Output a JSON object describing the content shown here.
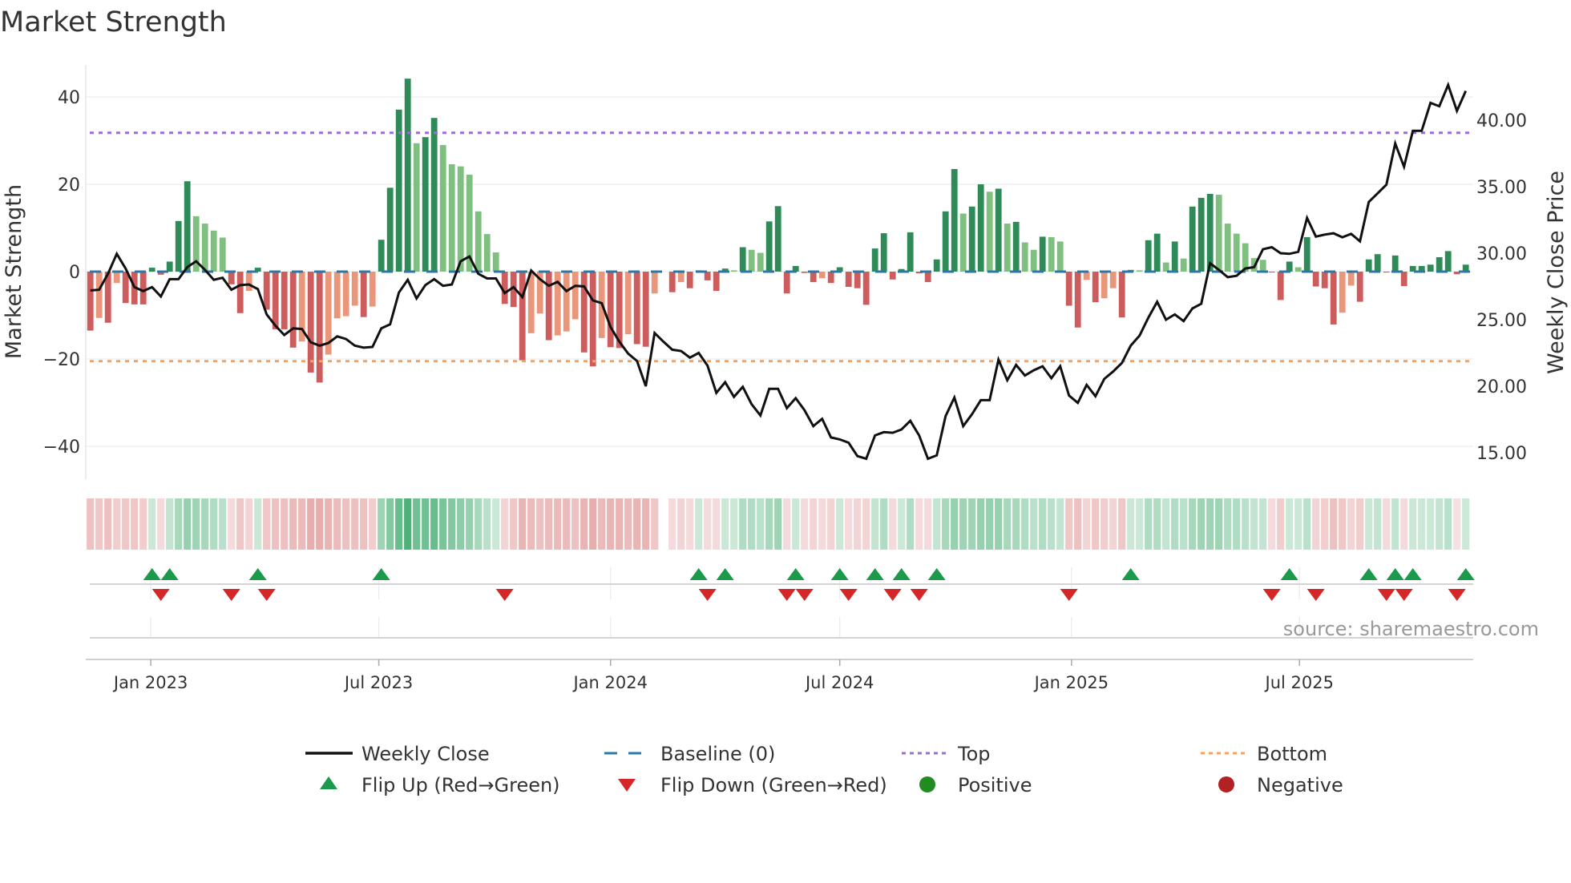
{
  "chart_data": {
    "type": "bar",
    "title": "Market Strength",
    "ylabel": "Market Strength",
    "y2label": "Weekly Close Price",
    "source": "source: sharemaestro.com",
    "ylim": [
      -48,
      48
    ],
    "y2lim": [
      13,
      43.5
    ],
    "yticks": [
      40,
      20,
      0,
      -20,
      -40
    ],
    "yticklabels": [
      "40",
      "20",
      "0",
      "−20",
      "−40"
    ],
    "y2ticks": [
      40,
      35,
      30,
      25,
      20,
      15
    ],
    "y2ticklabels": [
      "40.00",
      "35.00",
      "30.00",
      "25.00",
      "20.00",
      "15.00"
    ],
    "xticks": [
      "2023-01-01",
      "2023-07-01",
      "2024-01-01",
      "2024-07-01",
      "2025-01-01",
      "2025-07-01"
    ],
    "xticklabels": [
      "Jan 2023",
      "Jul 2023",
      "Jan 2024",
      "Jul 2024",
      "Jan 2025",
      "Jul 2025"
    ],
    "grid": true,
    "legend_placement": "bottom",
    "top_level": 31.8,
    "bottom_level": -20.5,
    "colors": {
      "pos_strong": "#2e8b57",
      "pos_weak": "#7fbf7f",
      "neg_strong": "#cd5c5c",
      "neg_weak": "#e9967a",
      "close": "#111111",
      "baseline": "#2a78a8",
      "top": "#9b6ddb",
      "bottom": "#f4a261",
      "flip_up": "#1a9a4a",
      "flip_down": "#d62728",
      "positive": "#228b22",
      "negative": "#b22222",
      "heat_pos": "#2ca25f",
      "heat_neg": "#d46a6a"
    },
    "dates": [
      "2022-11-14",
      "2022-11-21",
      "2022-11-28",
      "2022-12-05",
      "2022-12-12",
      "2022-12-19",
      "2022-12-26",
      "2023-01-02",
      "2023-01-09",
      "2023-01-16",
      "2023-01-23",
      "2023-01-30",
      "2023-02-06",
      "2023-02-13",
      "2023-02-20",
      "2023-02-27",
      "2023-03-06",
      "2023-03-13",
      "2023-03-20",
      "2023-03-27",
      "2023-04-03",
      "2023-04-10",
      "2023-04-17",
      "2023-04-24",
      "2023-05-01",
      "2023-05-08",
      "2023-05-15",
      "2023-05-22",
      "2023-05-29",
      "2023-06-05",
      "2023-06-12",
      "2023-06-19",
      "2023-06-26",
      "2023-07-03",
      "2023-07-10",
      "2023-07-17",
      "2023-07-24",
      "2023-07-31",
      "2023-08-07",
      "2023-08-14",
      "2023-08-21",
      "2023-08-28",
      "2023-09-04",
      "2023-09-11",
      "2023-09-18",
      "2023-09-25",
      "2023-10-02",
      "2023-10-09",
      "2023-10-16",
      "2023-10-23",
      "2023-10-30",
      "2023-11-06",
      "2023-11-13",
      "2023-11-20",
      "2023-11-27",
      "2023-12-04",
      "2023-12-11",
      "2023-12-18",
      "2023-12-25",
      "2024-01-01",
      "2024-01-08",
      "2024-01-15",
      "2024-01-22",
      "2024-01-29",
      "2024-02-05",
      "2024-02-12",
      "2024-02-19",
      "2024-02-26",
      "2024-03-04",
      "2024-03-11",
      "2024-03-18",
      "2024-03-25",
      "2024-04-01",
      "2024-04-08",
      "2024-04-15",
      "2024-04-22",
      "2024-04-29",
      "2024-05-06",
      "2024-05-13",
      "2024-05-20",
      "2024-05-27",
      "2024-06-03",
      "2024-06-10",
      "2024-06-17",
      "2024-06-24",
      "2024-07-01",
      "2024-07-08",
      "2024-07-15",
      "2024-07-22",
      "2024-07-29",
      "2024-08-05",
      "2024-08-12",
      "2024-08-19",
      "2024-08-26",
      "2024-09-02",
      "2024-09-09",
      "2024-09-16",
      "2024-09-23",
      "2024-09-30",
      "2024-10-07",
      "2024-10-14",
      "2024-10-21",
      "2024-10-28",
      "2024-11-04",
      "2024-11-11",
      "2024-11-18",
      "2024-11-25",
      "2024-12-02",
      "2024-12-09",
      "2024-12-16",
      "2024-12-23",
      "2024-12-30",
      "2025-01-06",
      "2025-01-13",
      "2025-01-20",
      "2025-01-27",
      "2025-02-03",
      "2025-02-10",
      "2025-02-17",
      "2025-02-24",
      "2025-03-03",
      "2025-03-10",
      "2025-03-17",
      "2025-03-24",
      "2025-03-31",
      "2025-04-07",
      "2025-04-14",
      "2025-04-21",
      "2025-04-28",
      "2025-05-05",
      "2025-05-12",
      "2025-05-19",
      "2025-05-26",
      "2025-06-02",
      "2025-06-09",
      "2025-06-16",
      "2025-06-23",
      "2025-06-30",
      "2025-07-07",
      "2025-07-14",
      "2025-07-21",
      "2025-07-28",
      "2025-08-04",
      "2025-08-11",
      "2025-08-18",
      "2025-08-25",
      "2025-09-01",
      "2025-09-08",
      "2025-09-15",
      "2025-09-22",
      "2025-09-29",
      "2025-10-06",
      "2025-10-13",
      "2025-10-20",
      "2025-10-27",
      "2025-11-03",
      "2025-11-10"
    ],
    "strength": [
      -13.5,
      -10.6,
      -11.7,
      -2.6,
      -7.2,
      -7.5,
      -7.5,
      0.9,
      -0.7,
      2.3,
      11.6,
      20.7,
      12.7,
      11.0,
      9.4,
      7.8,
      -2.9,
      -9.5,
      -4.4,
      0.9,
      -8.7,
      -13.2,
      -13.2,
      -17.4,
      -16.0,
      -23.1,
      -25.4,
      -19.0,
      -10.7,
      -10.2,
      -7.8,
      -10.4,
      -8.0,
      7.3,
      19.2,
      37.1,
      44.2,
      29.4,
      30.8,
      35.2,
      29.0,
      24.6,
      24.1,
      22.2,
      13.8,
      8.6,
      4.4,
      -7.4,
      -8.1,
      -20.3,
      -14.1,
      -9.6,
      -15.7,
      -14.6,
      -13.7,
      -10.9,
      -18.5,
      -21.7,
      -15.2,
      -17.3,
      -17.5,
      -14.3,
      -16.6,
      -17.2,
      -5.0,
      null,
      -4.7,
      -2.4,
      -3.8,
      0.3,
      -2.0,
      -4.4,
      0.7,
      0.3,
      5.6,
      5.0,
      4.3,
      11.5,
      15.0,
      -5.0,
      1.3,
      -0.3,
      -2.4,
      -1.5,
      -2.6,
      1.0,
      -3.5,
      -3.8,
      -7.6,
      5.3,
      8.8,
      -1.8,
      0.6,
      9.0,
      -0.4,
      -2.4,
      2.8,
      13.8,
      23.5,
      13.3,
      14.9,
      20.0,
      18.3,
      19.0,
      11.0,
      11.4,
      6.7,
      5.0,
      8.0,
      7.9,
      6.9,
      -7.8,
      -12.8,
      -1.9,
      -7.0,
      -6.1,
      -3.8,
      -10.5,
      0.4,
      0.3,
      7.2,
      8.7,
      2.1,
      6.9,
      3.0,
      14.9,
      16.9,
      17.8,
      17.6,
      11.0,
      8.7,
      6.5,
      3.1,
      2.7,
      -0.2,
      -6.5,
      2.3,
      1.0,
      7.9,
      -3.4,
      -3.8,
      -12.1,
      -9.4,
      -3.2,
      -6.9,
      2.8,
      4.0,
      -0.2,
      3.7,
      -3.3,
      1.3,
      1.3,
      1.6,
      3.3,
      4.7,
      -0.6,
      1.6
    ],
    "close": [
      27.2,
      27.25,
      28.45,
      29.95,
      28.85,
      27.45,
      27.15,
      27.45,
      26.75,
      28.05,
      28.05,
      28.95,
      29.4,
      28.75,
      28.0,
      28.15,
      27.25,
      27.6,
      27.65,
      27.3,
      25.4,
      24.55,
      23.85,
      24.35,
      24.3,
      23.3,
      23.05,
      23.25,
      23.75,
      23.55,
      23.05,
      22.9,
      22.95,
      24.35,
      24.65,
      27.05,
      28.0,
      26.6,
      27.6,
      28.05,
      27.55,
      27.65,
      29.4,
      29.75,
      28.45,
      28.1,
      28.1,
      27.0,
      27.45,
      26.7,
      28.7,
      28.05,
      27.55,
      27.85,
      27.15,
      27.55,
      27.5,
      26.45,
      26.25,
      24.45,
      23.35,
      22.45,
      21.9,
      20.0,
      24.0,
      23.35,
      22.75,
      22.65,
      22.15,
      22.5,
      21.55,
      19.5,
      20.3,
      19.2,
      19.95,
      18.65,
      17.8,
      19.8,
      19.8,
      18.35,
      19.1,
      18.2,
      17.0,
      17.55,
      16.15,
      16.0,
      15.75,
      14.75,
      14.55,
      16.3,
      16.55,
      16.5,
      16.75,
      17.4,
      16.3,
      14.55,
      14.8,
      17.75,
      19.15,
      17.0,
      17.9,
      18.95,
      18.95,
      22.0,
      20.45,
      21.6,
      20.8,
      21.2,
      21.5,
      20.6,
      21.5,
      19.3,
      18.75,
      20.1,
      19.25,
      20.55,
      21.1,
      21.75,
      23.05,
      23.8,
      25.15,
      26.35,
      25.0,
      25.4,
      24.9,
      25.85,
      26.2,
      29.25,
      28.75,
      28.2,
      28.3,
      28.85,
      28.95,
      30.3,
      30.45,
      30.0,
      29.95,
      30.1,
      32.65,
      31.25,
      31.4,
      31.5,
      31.2,
      31.45,
      30.9,
      33.85,
      34.5,
      35.15,
      38.25,
      36.5,
      39.2,
      39.2,
      41.3,
      41.05,
      42.65,
      40.7,
      42.2
    ],
    "heat": [
      -0.35,
      -0.3,
      -0.35,
      -0.25,
      -0.3,
      -0.3,
      -0.25,
      0.15,
      -0.15,
      0.2,
      0.35,
      0.45,
      0.4,
      0.35,
      0.3,
      0.25,
      -0.15,
      -0.3,
      -0.2,
      0.15,
      -0.3,
      -0.35,
      -0.35,
      -0.4,
      -0.4,
      -0.5,
      -0.5,
      -0.45,
      -0.4,
      -0.35,
      -0.35,
      -0.35,
      -0.25,
      0.4,
      0.55,
      0.7,
      0.85,
      0.65,
      0.65,
      0.7,
      0.6,
      0.55,
      0.5,
      0.45,
      0.35,
      0.25,
      0.15,
      -0.2,
      -0.3,
      -0.45,
      -0.4,
      -0.35,
      -0.4,
      -0.4,
      -0.4,
      -0.35,
      -0.45,
      -0.5,
      -0.4,
      -0.45,
      -0.45,
      -0.4,
      -0.45,
      -0.45,
      -0.3,
      null,
      -0.15,
      -0.2,
      -0.15,
      0.15,
      -0.15,
      -0.15,
      0.15,
      0.15,
      0.3,
      0.3,
      0.25,
      0.35,
      0.4,
      -0.15,
      0.15,
      -0.15,
      -0.2,
      -0.15,
      -0.2,
      0.15,
      -0.15,
      -0.2,
      -0.2,
      0.2,
      0.3,
      -0.15,
      0.15,
      0.3,
      -0.15,
      -0.15,
      0.2,
      0.35,
      0.45,
      0.4,
      0.4,
      0.45,
      0.45,
      0.45,
      0.35,
      0.35,
      0.3,
      0.25,
      0.3,
      0.25,
      0.2,
      -0.3,
      -0.35,
      -0.2,
      -0.3,
      -0.25,
      -0.2,
      -0.3,
      0.15,
      0.15,
      0.3,
      0.3,
      0.2,
      0.3,
      0.25,
      0.35,
      0.4,
      0.4,
      0.4,
      0.3,
      0.3,
      0.25,
      0.2,
      0.2,
      -0.15,
      -0.25,
      0.15,
      0.15,
      0.25,
      -0.2,
      -0.25,
      -0.35,
      -0.3,
      -0.2,
      -0.25,
      0.15,
      0.2,
      -0.15,
      0.2,
      -0.15,
      0.15,
      0.15,
      0.15,
      0.2,
      0.25,
      -0.1,
      0.15
    ],
    "flip_up": [
      "2023-01-02",
      "2023-01-16",
      "2023-03-27",
      "2023-07-03",
      "2024-03-11",
      "2024-04-01",
      "2024-05-27",
      "2024-07-01",
      "2024-07-29",
      "2024-08-19",
      "2024-09-16",
      "2025-02-17",
      "2025-06-23",
      "2025-08-25",
      "2025-09-15",
      "2025-09-29",
      "2025-11-10"
    ],
    "flip_down": [
      "2023-01-09",
      "2023-03-06",
      "2023-04-03",
      "2023-10-09",
      "2024-03-18",
      "2024-05-20",
      "2024-06-03",
      "2024-07-08",
      "2024-08-12",
      "2024-09-02",
      "2024-12-30",
      "2025-06-09",
      "2025-07-14",
      "2025-09-08",
      "2025-09-22",
      "2025-11-03"
    ],
    "legend": [
      {
        "label": "Weekly Close",
        "kind": "line"
      },
      {
        "label": "Baseline (0)",
        "kind": "dash"
      },
      {
        "label": "Top",
        "kind": "dot-top"
      },
      {
        "label": "Bottom",
        "kind": "dot-bottom"
      },
      {
        "label": "Flip Up (Red→Green)",
        "kind": "tri-up"
      },
      {
        "label": "Flip Down (Green→Red)",
        "kind": "tri-down"
      },
      {
        "label": "Positive",
        "kind": "dot-pos"
      },
      {
        "label": "Negative",
        "kind": "dot-neg"
      }
    ]
  }
}
